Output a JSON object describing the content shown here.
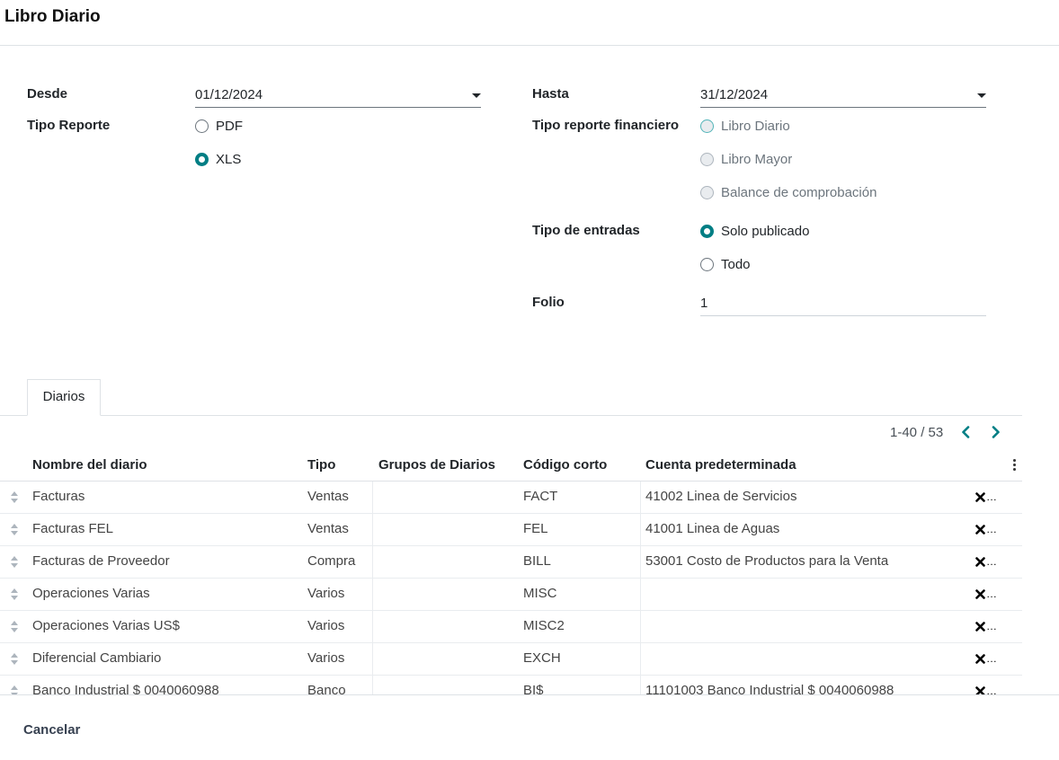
{
  "header": {
    "title": "Libro Diario"
  },
  "form": {
    "desde": {
      "label": "Desde",
      "value": "01/12/2024"
    },
    "hasta": {
      "label": "Hasta",
      "value": "31/12/2024"
    },
    "tipo_reporte": {
      "label": "Tipo Reporte",
      "options": [
        "PDF",
        "XLS"
      ],
      "selected": "XLS"
    },
    "tipo_reporte_financiero": {
      "label": "Tipo reporte financiero",
      "options": [
        "Libro Diario",
        "Libro Mayor",
        "Balance de comprobación"
      ]
    },
    "tipo_entradas": {
      "label": "Tipo de entradas",
      "options": [
        "Solo publicado",
        "Todo"
      ],
      "selected": "Solo publicado"
    },
    "folio": {
      "label": "Folio",
      "value": "1"
    }
  },
  "tabs": [
    {
      "label": "Diarios"
    }
  ],
  "pager": {
    "value": "1-40 / 53"
  },
  "table": {
    "columns": [
      "Nombre del diario",
      "Tipo",
      "Grupos de Diarios",
      "Código corto",
      "Cuenta predeterminada"
    ],
    "rows": [
      {
        "name": "Facturas",
        "type": "Ventas",
        "groups": "",
        "code": "FACT",
        "account": "41002 Linea de Servicios"
      },
      {
        "name": "Facturas FEL",
        "type": "Ventas",
        "groups": "",
        "code": "FEL",
        "account": "41001 Linea de Aguas"
      },
      {
        "name": "Facturas de Proveedor",
        "type": "Compra",
        "groups": "",
        "code": "BILL",
        "account": "53001 Costo de Productos para la Venta"
      },
      {
        "name": "Operaciones Varias",
        "type": "Varios",
        "groups": "",
        "code": "MISC",
        "account": ""
      },
      {
        "name": "Operaciones Varias US$",
        "type": "Varios",
        "groups": "",
        "code": "MISC2",
        "account": ""
      },
      {
        "name": "Diferencial Cambiario",
        "type": "Varios",
        "groups": "",
        "code": "EXCH",
        "account": ""
      },
      {
        "name": "Banco Industrial $ 0040060988",
        "type": "Banco",
        "groups": "",
        "code": "BI$",
        "account": "11101003 Banco Industrial $ 0040060988"
      }
    ]
  },
  "footer": {
    "cancel_label": "Cancelar"
  },
  "colors": {
    "accent": "#017e84"
  }
}
